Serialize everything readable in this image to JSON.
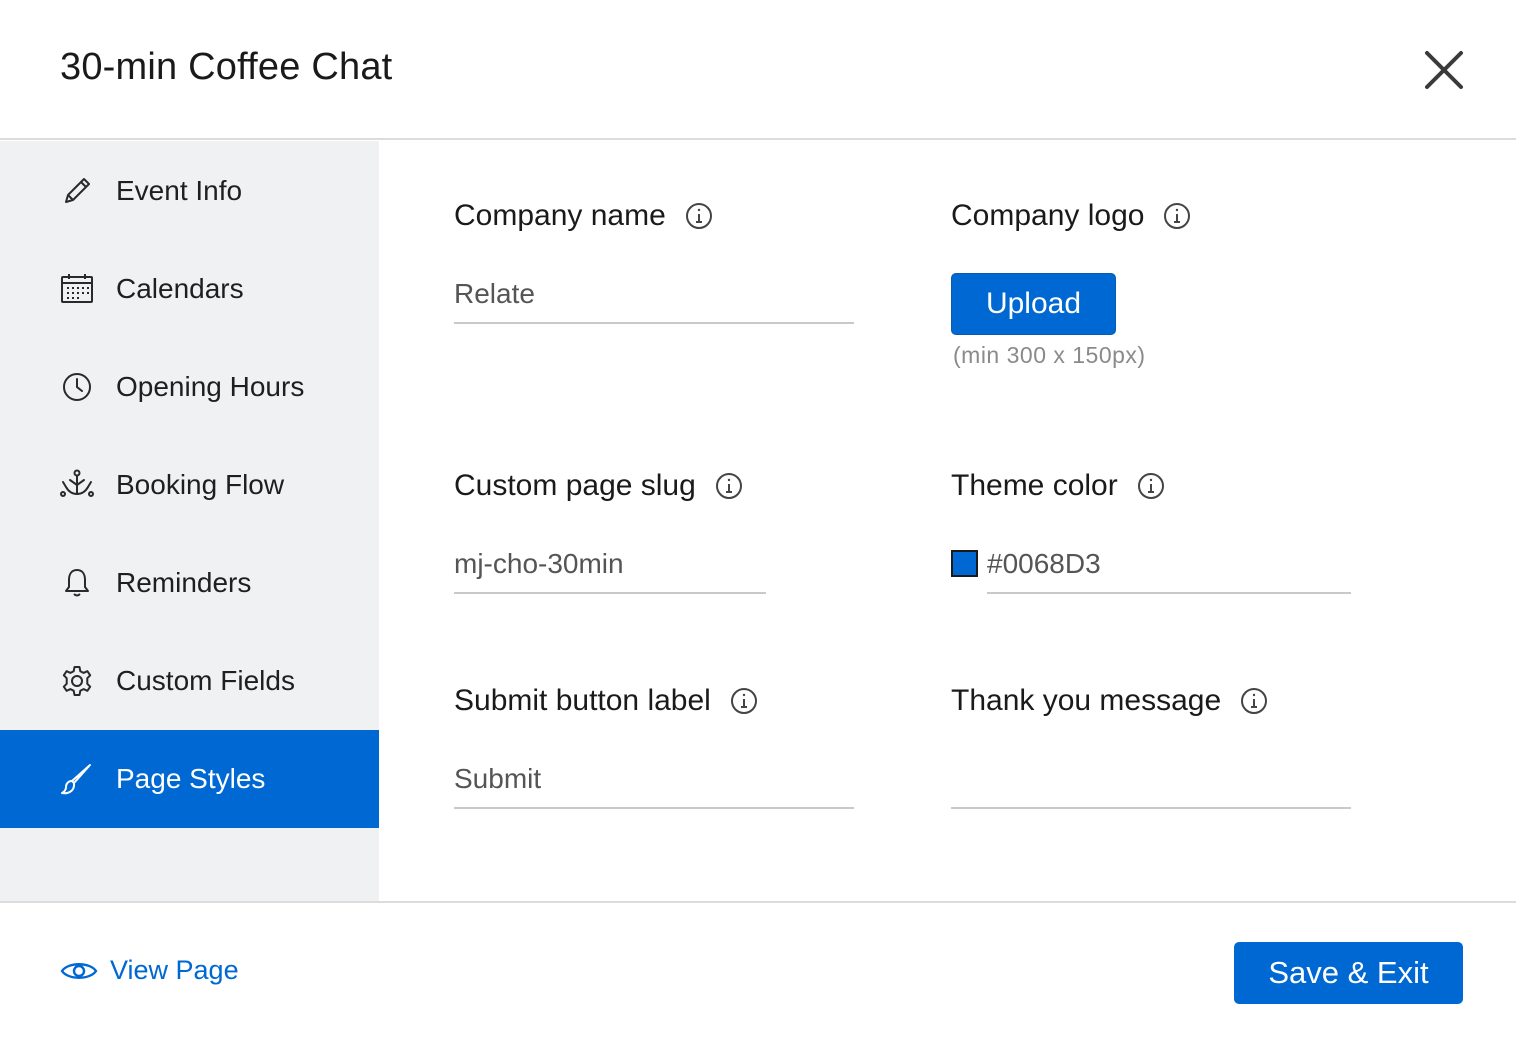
{
  "dialog": {
    "title": "30-min Coffee Chat"
  },
  "sidebar": {
    "items": [
      {
        "label": "Event Info",
        "icon": "pencil-icon"
      },
      {
        "label": "Calendars",
        "icon": "calendar-icon"
      },
      {
        "label": "Opening Hours",
        "icon": "clock-icon"
      },
      {
        "label": "Booking Flow",
        "icon": "flow-icon"
      },
      {
        "label": "Reminders",
        "icon": "bell-icon"
      },
      {
        "label": "Custom Fields",
        "icon": "gear-icon"
      },
      {
        "label": "Page Styles",
        "icon": "brush-icon",
        "active": true
      }
    ]
  },
  "form": {
    "company_name": {
      "label": "Company name",
      "value": "Relate"
    },
    "company_logo": {
      "label": "Company logo",
      "button": "Upload",
      "hint": "(min 300 x 150px)"
    },
    "custom_slug": {
      "label": "Custom page slug",
      "value": "mj-cho-30min"
    },
    "theme_color": {
      "label": "Theme color",
      "value": "#0068D3",
      "swatch": "#0068D3"
    },
    "submit_label": {
      "label": "Submit button label",
      "value": "Submit"
    },
    "thank_you": {
      "label": "Thank you message",
      "value": ""
    }
  },
  "footer": {
    "view_page": "View Page",
    "save": "Save & Exit"
  },
  "colors": {
    "accent": "#0068D3",
    "sidebar_bg": "#F0F1F3"
  }
}
